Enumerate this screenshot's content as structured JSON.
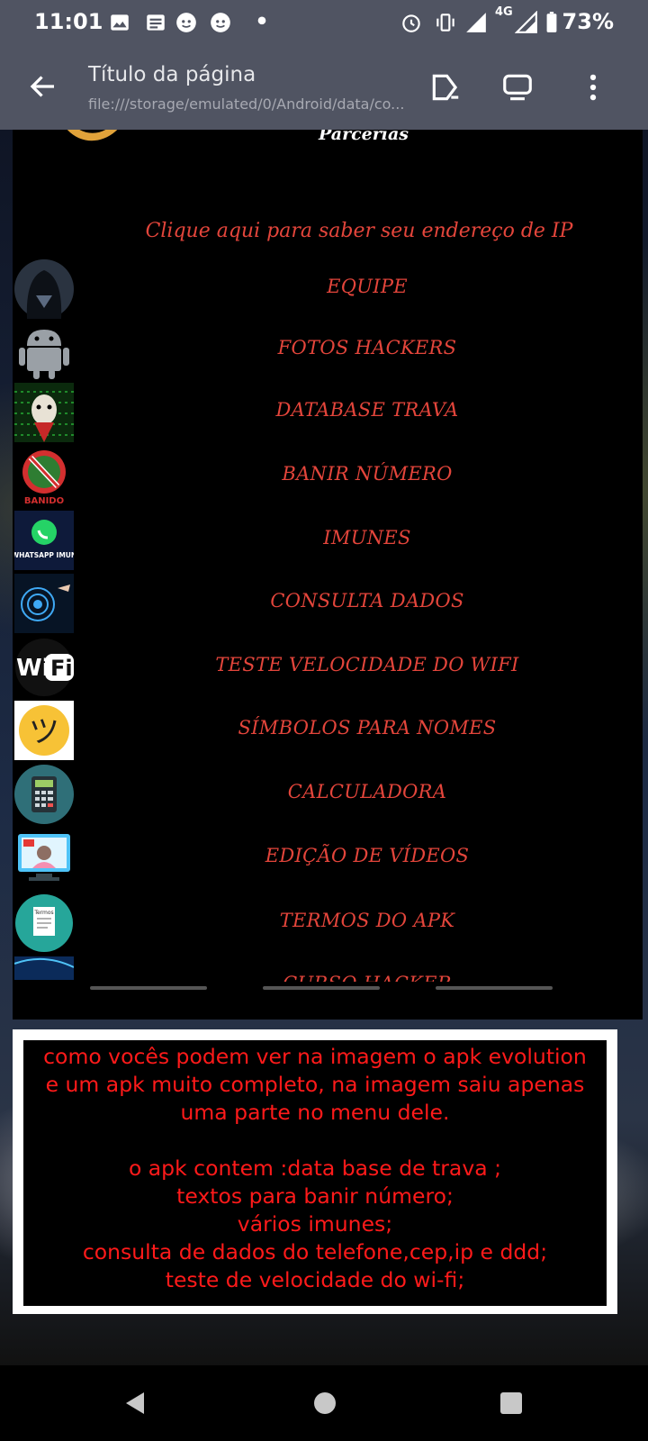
{
  "status_bar": {
    "time": "11:01",
    "network": "4G",
    "battery": "73%"
  },
  "app_bar": {
    "title": "Título da página",
    "url": "file:///storage/emulated/0/Android/data/co..."
  },
  "screenshot": {
    "partner_label": "Parcerias",
    "ip_link": "Clique aqui para saber seu endereço de IP",
    "menu_items": [
      {
        "label": "EQUIPE",
        "icon": "hooded-figure-icon"
      },
      {
        "label": "FOTOS HACKERS",
        "icon": "android-icon"
      },
      {
        "label": "DATABASE TRAVA",
        "icon": "anonymous-mask-icon"
      },
      {
        "label": "BANIR NÚMERO",
        "icon": "banned-whatsapp-icon",
        "icon_text": "BANIDO"
      },
      {
        "label": "IMUNES",
        "icon": "whatsapp-icon",
        "icon_text": "WHATSAPP IMUN"
      },
      {
        "label": "CONSULTA DADOS",
        "icon": "fingerprint-icon"
      },
      {
        "label": "TESTE VELOCIDADE DO WIFI",
        "icon": "wifi-icon",
        "icon_text": "Wi Fi"
      },
      {
        "label": "SÍMBOLOS PARA NOMES",
        "icon": "smiley-icon",
        "icon_text": "ツ"
      },
      {
        "label": "CALCULADORA",
        "icon": "calculator-icon"
      },
      {
        "label": "EDIÇÃO DE VÍDEOS",
        "icon": "video-editing-icon"
      },
      {
        "label": "TERMOS DO APK",
        "icon": "document-icon",
        "icon_text": "Termos"
      },
      {
        "label": "CURSO HACKER",
        "icon": "hacker-course-icon"
      }
    ]
  },
  "description": {
    "lines": [
      "como vocês podem ver na imagem o apk evolution",
      "e um apk muito completo, na imagem saiu apenas",
      "uma parte no menu dele.",
      "",
      "o apk contem :data base de trava ;",
      "textos para banir número;",
      "vários imunes;",
      "consulta de dados do telefone,cep,ip e ddd;",
      "teste de velocidade do wi-fi;"
    ]
  },
  "colors": {
    "menu_text": "#e3453b",
    "description_text": "#ff1a1a",
    "app_bar": "#505462"
  }
}
